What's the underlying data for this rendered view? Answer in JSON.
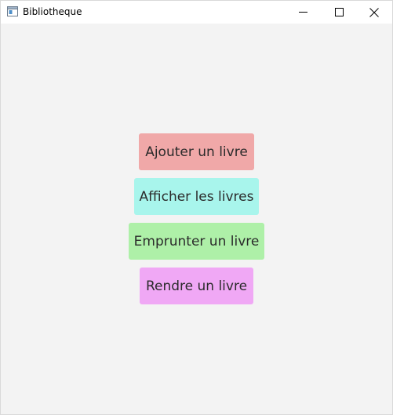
{
  "window": {
    "title": "Bibliotheque"
  },
  "icons": {
    "app": "window-app-icon",
    "minimize": "minimize-icon",
    "maximize": "maximize-icon",
    "close": "close-icon"
  },
  "menu": {
    "buttons": [
      {
        "label": "Ajouter un livre",
        "color": "#f0a8a8"
      },
      {
        "label": "Afficher les livres",
        "color": "#a8f5ec"
      },
      {
        "label": "Emprunter un livre",
        "color": "#aef0a8"
      },
      {
        "label": "Rendre un livre",
        "color": "#f0a8f5"
      }
    ]
  }
}
